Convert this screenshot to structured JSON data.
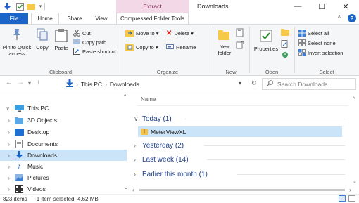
{
  "window": {
    "title": "Downloads",
    "context_tab_header": "Extract",
    "minimize": "—",
    "maximize": "☐",
    "close": "✕"
  },
  "tabs": {
    "file": "File",
    "home": "Home",
    "share": "Share",
    "view": "View",
    "compressed": "Compressed Folder Tools"
  },
  "ribbon": {
    "clipboard": {
      "group": "Clipboard",
      "pin": "Pin to Quick access",
      "copy": "Copy",
      "paste": "Paste",
      "cut": "Cut",
      "copy_path": "Copy path",
      "paste_shortcut": "Paste shortcut"
    },
    "organize": {
      "group": "Organize",
      "move_to": "Move to ▾",
      "delete": "Delete ▾",
      "copy_to": "Copy to ▾",
      "rename": "Rename"
    },
    "new": {
      "group": "New",
      "new_folder": "New folder"
    },
    "open": {
      "group": "Open",
      "properties": "Properties"
    },
    "select": {
      "group": "Select",
      "select_all": "Select all",
      "select_none": "Select none",
      "invert": "Invert selection"
    }
  },
  "address": {
    "path_root": "This PC",
    "path_sep": "›",
    "path_leaf": "Downloads",
    "search_placeholder": "Search Downloads"
  },
  "nav": {
    "items": [
      {
        "label": "This PC",
        "expanded": true,
        "icon": "pc-icon"
      },
      {
        "label": "3D Objects",
        "icon": "3d-objects-icon"
      },
      {
        "label": "Desktop",
        "icon": "desktop-icon"
      },
      {
        "label": "Documents",
        "icon": "documents-icon"
      },
      {
        "label": "Downloads",
        "icon": "downloads-icon",
        "selected": true
      },
      {
        "label": "Music",
        "icon": "music-icon"
      },
      {
        "label": "Pictures",
        "icon": "pictures-icon"
      },
      {
        "label": "Videos",
        "icon": "videos-icon"
      }
    ]
  },
  "content": {
    "column_name": "Name",
    "groups": [
      {
        "label": "Today (1)",
        "expanded": true
      },
      {
        "label": "Yesterday (2)"
      },
      {
        "label": "Last week (14)"
      },
      {
        "label": "Earlier this month (1)"
      }
    ],
    "file": "MeterViewXL"
  },
  "status": {
    "items": "823 items",
    "selected": "1 item selected  4.62 MB"
  },
  "colors": {
    "accent": "#1a65c7",
    "selection": "#cce4f7",
    "context_tab": "#f3d9e8"
  }
}
